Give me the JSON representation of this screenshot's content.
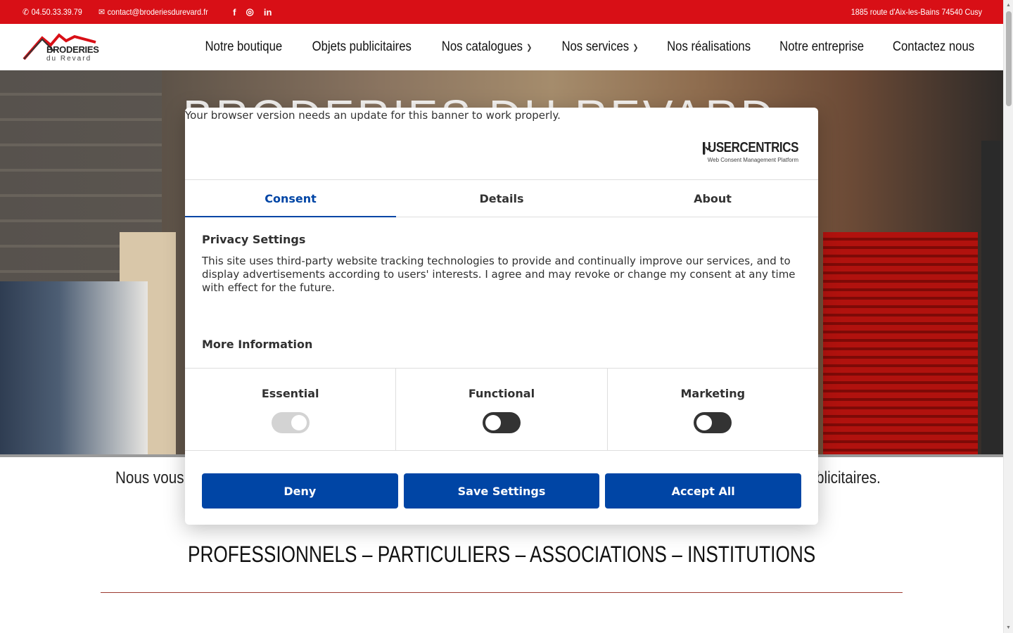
{
  "topbar": {
    "phone": "04.50.33.39.79",
    "email": "contact@broderiesdurevard.fr",
    "address": "1885 route d'Aix-les-Bains 74540 Cusy",
    "social": [
      "f",
      "◎",
      "in"
    ]
  },
  "logo": {
    "line1": "BRODERIES",
    "line2": "du Revard"
  },
  "nav": [
    {
      "label": "Notre boutique",
      "has_submenu": false
    },
    {
      "label": "Objets publicitaires",
      "has_submenu": false
    },
    {
      "label": "Nos catalogues",
      "has_submenu": true
    },
    {
      "label": "Nos services",
      "has_submenu": true
    },
    {
      "label": "Nos réalisations",
      "has_submenu": false
    },
    {
      "label": "Notre entreprise",
      "has_submenu": false
    },
    {
      "label": "Contactez nous",
      "has_submenu": false
    }
  ],
  "hero": {
    "title": "BRODERIES DU REVARD"
  },
  "intro": {
    "left": "Nous vous",
    "right": "blicitaires."
  },
  "tagline": "PROFESSIONNELS – PARTICULIERS – ASSOCIATIONS – INSTITUTIONS",
  "consent": {
    "browser_note": "Your browser version needs an update for this banner to work properly.",
    "brand": "USERCENTRICS",
    "brand_sub": "Web Consent Management Platform",
    "tabs": [
      {
        "label": "Consent",
        "active": true
      },
      {
        "label": "Details",
        "active": false
      },
      {
        "label": "About",
        "active": false
      }
    ],
    "heading": "Privacy Settings",
    "body": "This site uses third-party website tracking technologies to provide and continually improve our services, and to display advertisements according to users' interests. I agree and may revoke or change my consent at any time with effect for the future.",
    "more_info": "More Information",
    "categories": [
      {
        "label": "Essential",
        "state": "on-disabled"
      },
      {
        "label": "Functional",
        "state": "off"
      },
      {
        "label": "Marketing",
        "state": "off"
      }
    ],
    "buttons": {
      "deny": "Deny",
      "save": "Save Settings",
      "accept": "Accept All"
    },
    "accent_color": "#0045a5"
  },
  "colors": {
    "topbar": "#d80f16"
  }
}
